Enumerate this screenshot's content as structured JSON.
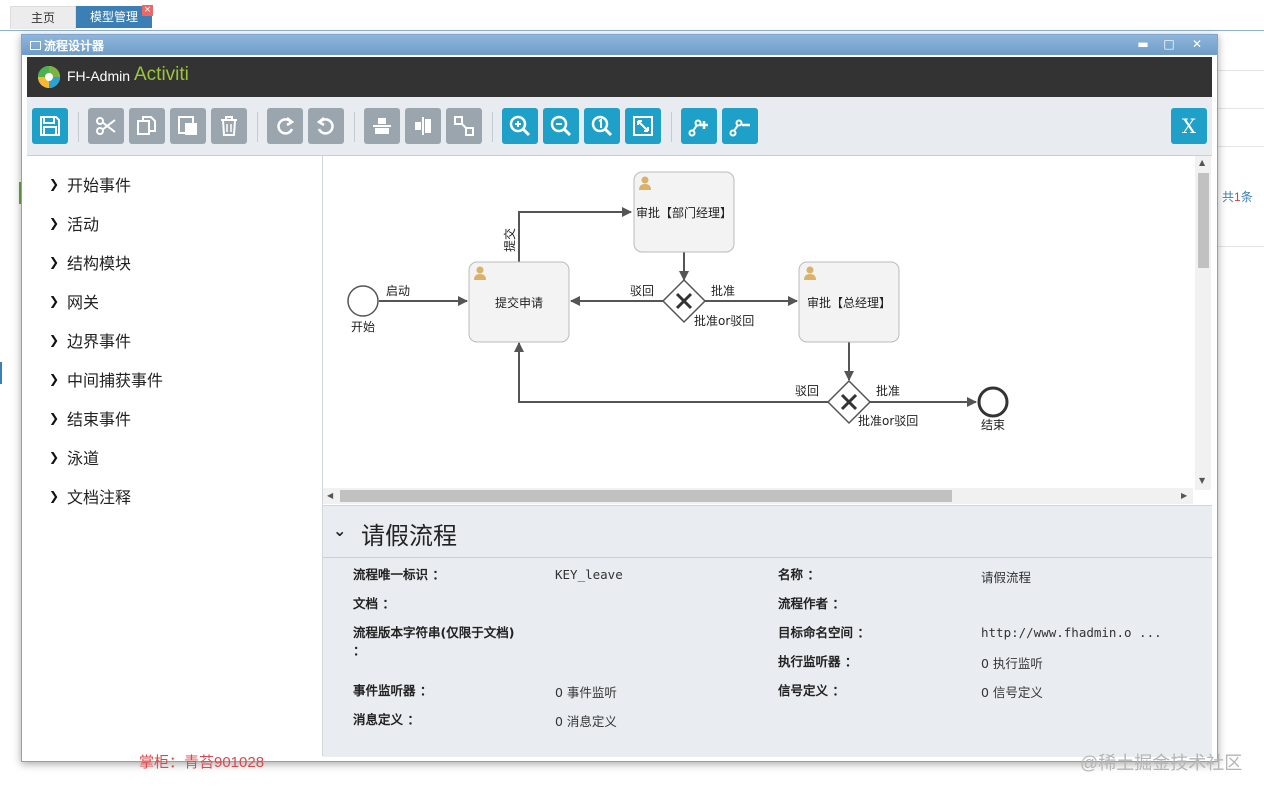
{
  "app_tabs": {
    "home": "主页",
    "model": "模型管理",
    "close": "×"
  },
  "bg": {
    "count_prefix": "共",
    "count_num": "1",
    "count_suffix": "条"
  },
  "dialog": {
    "title": "流程设计器",
    "minimize": "▬",
    "maximize": "□",
    "close": "✕"
  },
  "brand": {
    "name": "FH-Admin",
    "sub": "Activiti"
  },
  "toolbar": {
    "buttons": [
      "save-icon",
      "cut-icon",
      "copy-icon",
      "paste-icon",
      "delete-icon",
      "redo-icon",
      "undo-icon",
      "align-horizontal-icon",
      "align-vertical-icon",
      "same-size-icon",
      "zoom-in-icon",
      "zoom-out-icon",
      "zoom-actual-icon",
      "zoom-fit-icon",
      "bend-add-icon",
      "bend-remove-icon"
    ],
    "close_label": "X"
  },
  "palette": {
    "items": [
      "开始事件",
      "活动",
      "结构模块",
      "网关",
      "边界事件",
      "中间捕获事件",
      "结束事件",
      "泳道",
      "文档注释"
    ]
  },
  "diagram": {
    "start_label": "开始",
    "start_flow": "启动",
    "task_submit": "提交申请",
    "flow_submit": "提交",
    "task_dept": "审批【部门经理】",
    "gw1_reject": "驳回",
    "gw1_approve": "批准",
    "gw1_label": "批准or驳回",
    "task_gm": "审批【总经理】",
    "gw2_reject": "驳回",
    "gw2_approve": "批准",
    "gw2_label": "批准or驳回",
    "end_label": "结束"
  },
  "properties": {
    "title": "请假流程",
    "fields": {
      "process_id_label": "流程唯一标识 ：",
      "process_id_value": "KEY_leave",
      "name_label": "名称 ：",
      "name_value": "请假流程",
      "doc_label": "文档 ：",
      "author_label": "流程作者 ：",
      "version_label": "流程版本字符串(仅限于文档) ：",
      "namespace_label": "目标命名空间 ：",
      "namespace_value": "http://www.fhadmin.o ...",
      "exec_listener_label": "执行监听器 ：",
      "exec_listener_value": "0 执行监听",
      "event_listener_label": "事件监听器 ：",
      "event_listener_value": "0 事件监听",
      "signal_label": "信号定义 ：",
      "signal_value": "0 信号定义",
      "message_label": "消息定义 ：",
      "message_value": "0 消息定义"
    }
  },
  "watermarks": {
    "left": "掌柜：青苔901028",
    "right": "@稀土掘金技术社区"
  },
  "colors": {
    "accent": "#1ea0c8",
    "toolbar_gray": "#9aa5ad",
    "brand_green": "#9cc53a"
  }
}
